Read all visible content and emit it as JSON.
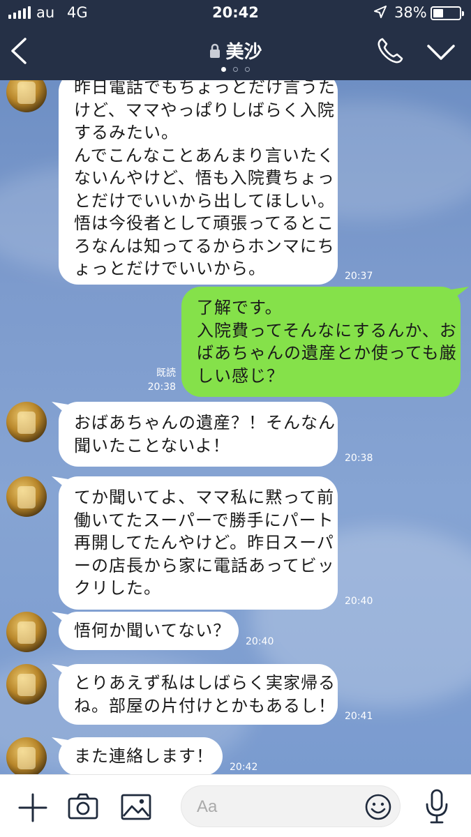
{
  "status_bar": {
    "carrier": "au",
    "network": "4G",
    "time": "20:42",
    "battery": "38%",
    "battery_level": 0.38
  },
  "header": {
    "title": "美沙",
    "page_indicator": {
      "count": 3,
      "active": 0
    }
  },
  "messages": [
    {
      "side": "left",
      "lines": [
        "昨日電話でもちょっとだけ言うた",
        "けど、ママやっぱりしばらく入院",
        "するみたい。",
        "んでこんなことあんまり言いたく",
        "ないんやけど、悟も入院費ちょっ",
        "とだけでいいから出してほしい。",
        "悟は今役者として頑張ってるとこ",
        "ろなんは知ってるからホンマにち",
        "ょっとだけでいいから。"
      ],
      "time": "20:37"
    },
    {
      "side": "right",
      "lines": [
        "了解です。",
        "入院費ってそんなにするんか、お",
        "ばあちゃんの遺産とか使っても厳",
        "しい感じ？"
      ],
      "time": "20:38",
      "read": "既読"
    },
    {
      "side": "left",
      "lines": [
        "おばあちゃんの遺産？！そんなん",
        "聞いたことないよ！"
      ],
      "time": "20:38"
    },
    {
      "side": "left",
      "lines": [
        "てか聞いてよ、ママ私に黙って前",
        "働いてたスーパーで勝手にパート",
        "再開してたんやけど。昨日スーパ",
        "ーの店長から家に電話あってビッ",
        "クリした。"
      ],
      "time": "20:40"
    },
    {
      "side": "left",
      "lines": [
        "悟何か聞いてない？"
      ],
      "time": "20:40"
    },
    {
      "side": "left",
      "lines": [
        "とりあえず私はしばらく実家帰る",
        "ね。部屋の片付けとかもあるし！"
      ],
      "time": "20:41"
    },
    {
      "side": "left",
      "lines": [
        "また連絡します！"
      ],
      "time": "20:42"
    }
  ],
  "composer": {
    "placeholder": "Aa"
  },
  "colors": {
    "header_bg": "#253046",
    "outgoing_bubble": "#85e14a",
    "incoming_bubble": "#ffffff",
    "chat_bg": "#7a97c7"
  }
}
